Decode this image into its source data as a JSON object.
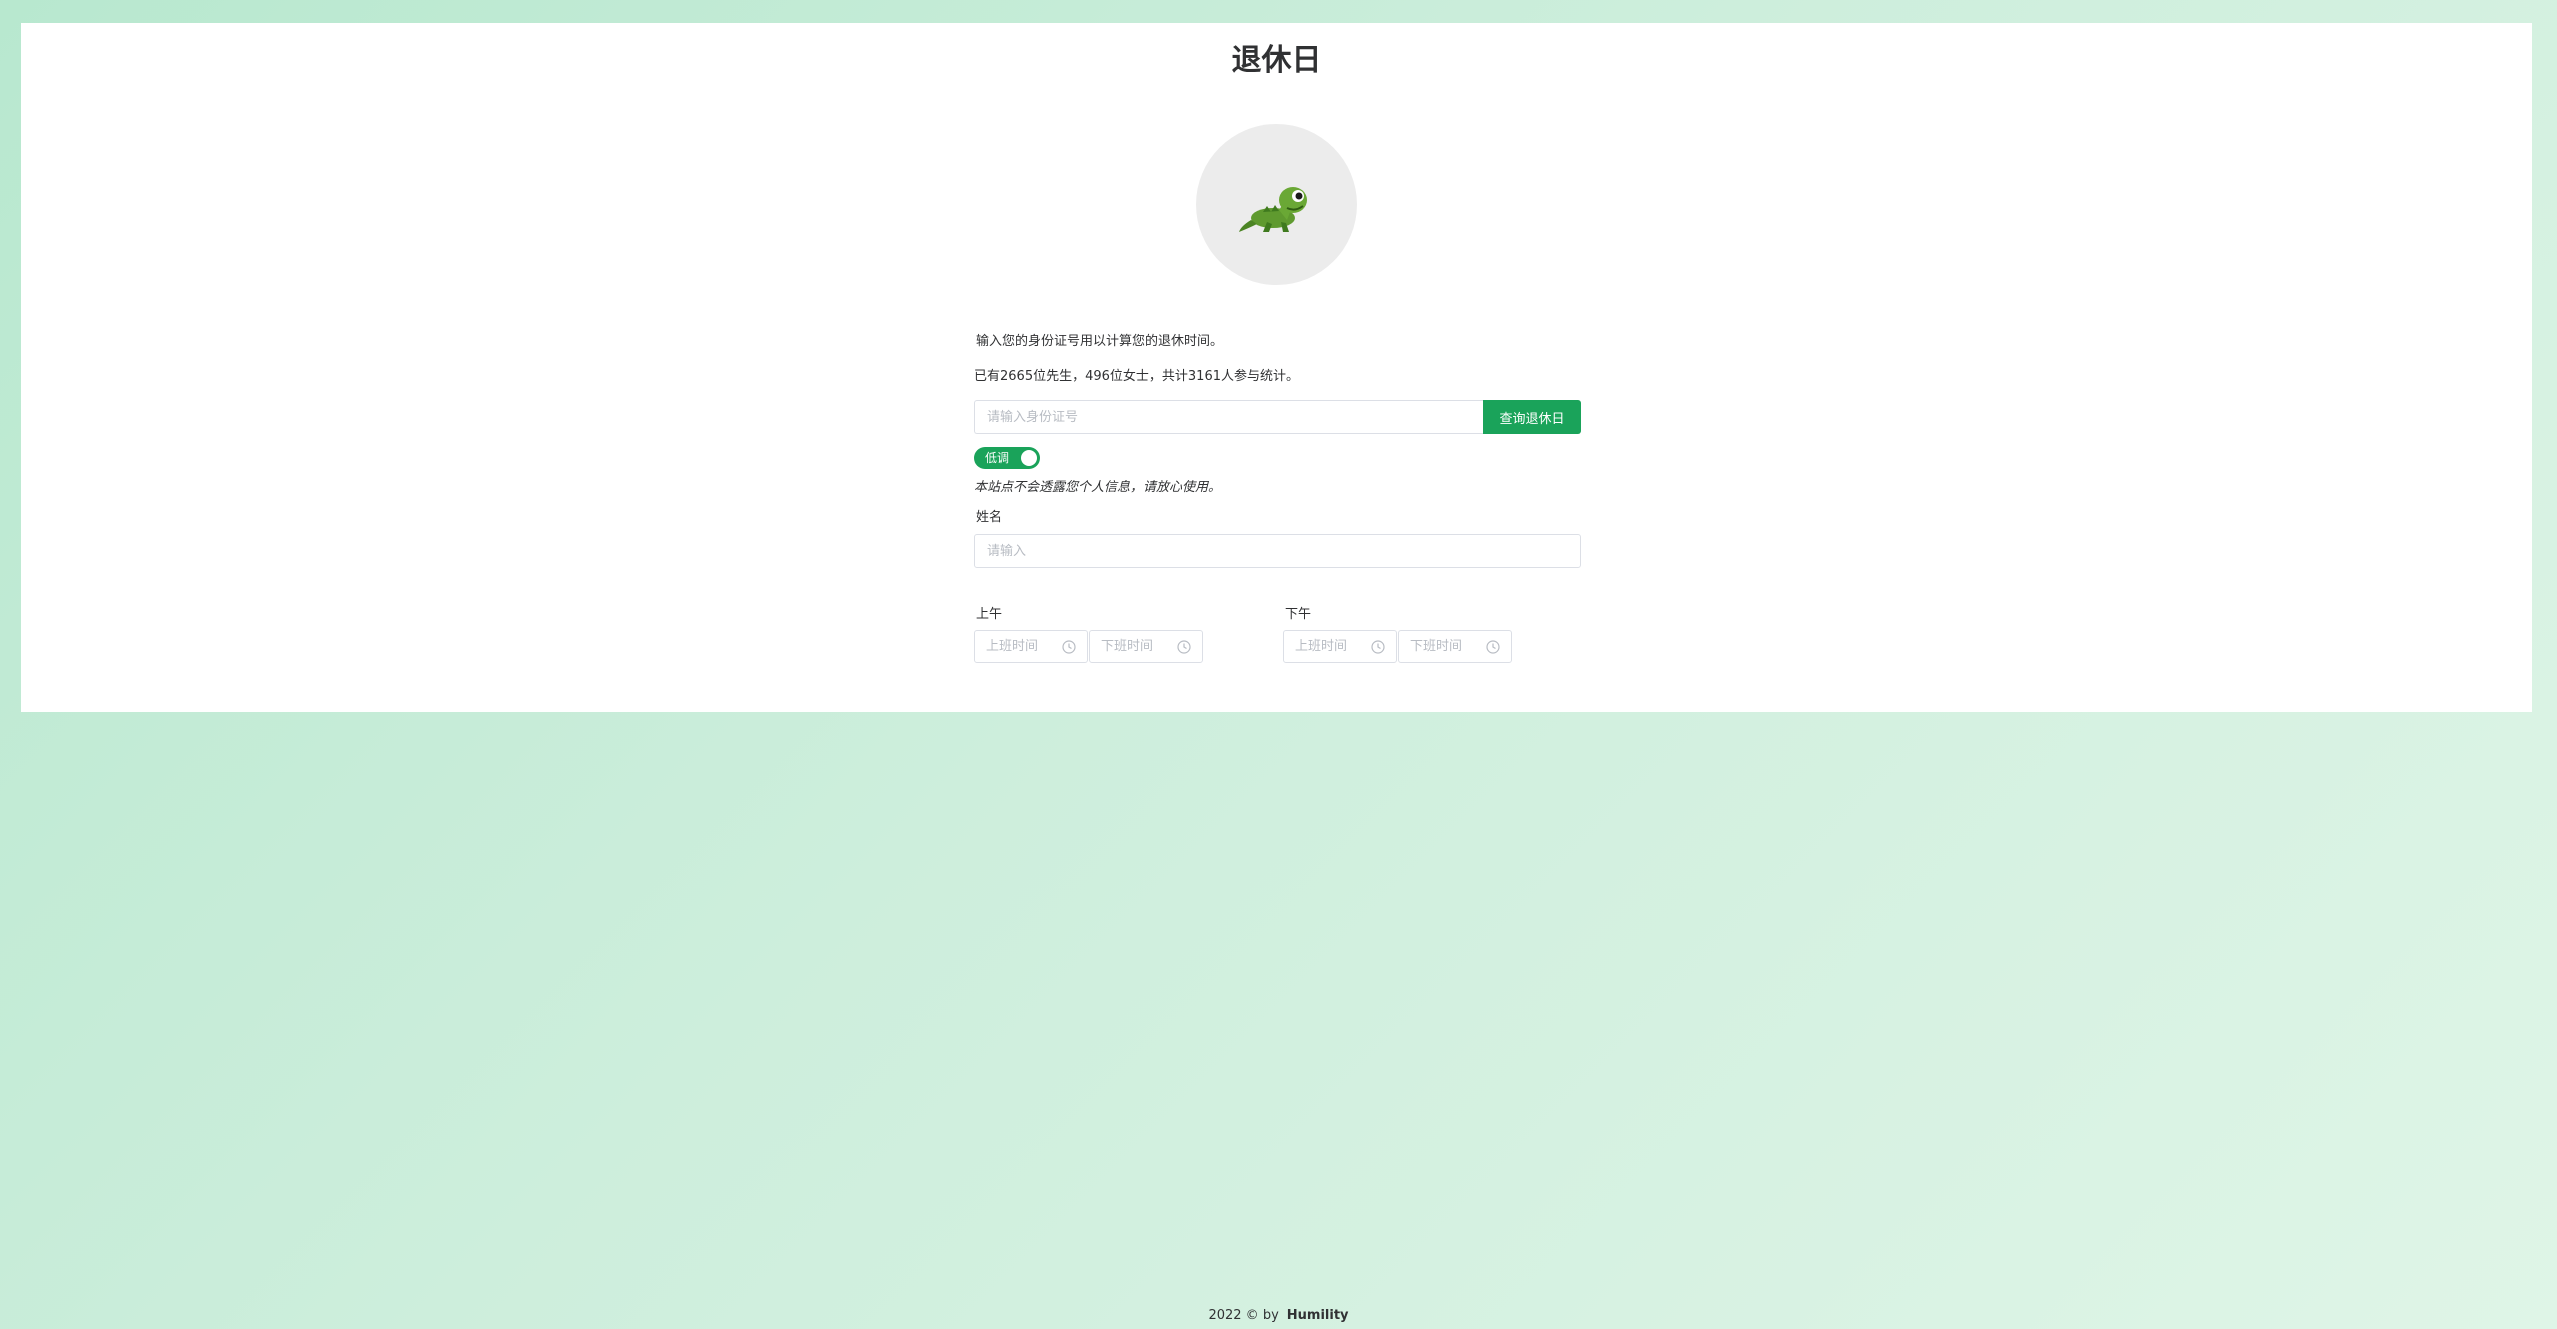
{
  "page": {
    "title": "退休日",
    "avatar_icon": "lizard-icon"
  },
  "intro": {
    "line1": "输入您的身份证号用以计算您的退休时间。",
    "line2": "已有2665位先生，496位女士，共计3161人参与统计。"
  },
  "id_search": {
    "placeholder": "请输入身份证号",
    "value": "",
    "button_label": "查询退休日"
  },
  "low_profile_toggle": {
    "label": "低调",
    "on": true
  },
  "privacy_note": "本站点不会透露您个人信息，请放心使用。",
  "name_field": {
    "label": "姓名",
    "placeholder": "请输入",
    "value": ""
  },
  "schedule": {
    "morning": {
      "label": "上午",
      "start_placeholder": "上班时间",
      "end_placeholder": "下班时间"
    },
    "afternoon": {
      "label": "下午",
      "start_placeholder": "上班时间",
      "end_placeholder": "下班时间"
    }
  },
  "footer": {
    "text": "2022 © by",
    "author": "Humility"
  },
  "colors": {
    "accent": "#1aa35a",
    "background_start": "#b8e8cf",
    "background_end": "#dff5e7"
  }
}
